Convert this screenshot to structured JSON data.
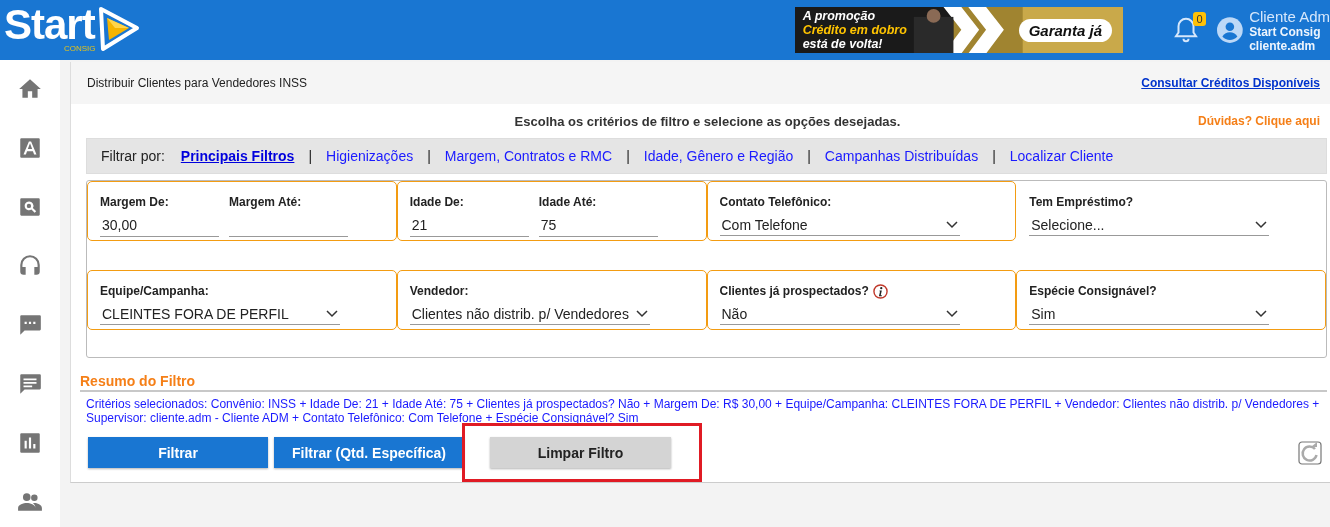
{
  "header": {
    "logo": "Start",
    "logo_sub": "CONSIG",
    "banner": {
      "line1": "A promoção",
      "line2": "Crédito em dobro",
      "line3": "está de volta!",
      "cta": "Garanta já"
    },
    "notifications": "0",
    "user": {
      "name": "Cliente Adm",
      "company": "Start Consig",
      "login": "cliente.adm"
    }
  },
  "sidebar": {
    "items": [
      {
        "kind": "home"
      },
      {
        "kind": "letter"
      },
      {
        "kind": "search"
      },
      {
        "kind": "headset"
      },
      {
        "kind": "chat"
      },
      {
        "kind": "message"
      },
      {
        "kind": "chart"
      },
      {
        "kind": "people"
      }
    ]
  },
  "page": {
    "title": "Distribuir Clientes para Vendedores INSS",
    "credits_link": "Consultar Créditos Disponíveis",
    "instruction": "Escolha os critérios de filtro e selecione as opções desejadas.",
    "help_link": "Dúvidas? Clique aqui"
  },
  "filter_tabs": {
    "label": "Filtrar por:",
    "tabs": [
      {
        "label": "Principais Filtros",
        "selected": true
      },
      {
        "separator": "|",
        "label": "Higienizações",
        "selected": false
      },
      {
        "separator": "|",
        "label": "Margem, Contratos e RMC",
        "selected": false
      },
      {
        "separator": "|",
        "label": "Idade, Gênero e Região",
        "selected": false
      },
      {
        "separator": "|",
        "label": "Campanhas Distribuídas",
        "selected": false
      },
      {
        "separator": "|",
        "label": "Localizar Cliente",
        "selected": false
      }
    ]
  },
  "filters": [
    {
      "kind": "pair",
      "highlighted": true,
      "fields": [
        {
          "label": "Margem De:",
          "value": "30,00"
        },
        {
          "label": "Margem Até:"
        }
      ]
    },
    {
      "kind": "pair",
      "highlighted": true,
      "fields": [
        {
          "label": "Idade De:",
          "value": "21"
        },
        {
          "label": "Idade Até:",
          "value": "75"
        }
      ]
    },
    {
      "kind": "select",
      "highlighted": true,
      "label": "Contato Telefônico:",
      "value": "Com Telefone",
      "info": false
    },
    {
      "kind": "select",
      "highlighted": false,
      "label": "Tem Empréstimo?",
      "value": "Selecione...",
      "info": false
    },
    {
      "kind": "select",
      "highlighted": true,
      "label": "Equipe/Campanha:",
      "value": "CLEINTES FORA DE PERFIL",
      "info": false
    },
    {
      "kind": "select",
      "highlighted": true,
      "label": "Vendedor:",
      "value": "Clientes não distrib. p/ Vendedores",
      "info": false
    },
    {
      "kind": "select",
      "highlighted": true,
      "label": "Clientes já prospectados?",
      "value": "Não",
      "info": true
    },
    {
      "kind": "select",
      "highlighted": true,
      "label": "Espécie Consignável?",
      "value": "Sim",
      "info": false
    }
  ],
  "summary": {
    "title": "Resumo do Filtro",
    "text": "Critérios selecionados: Convênio: INSS + Idade De: 21 + Idade Até: 75 + Clientes já prospectados? Não + Margem De: R$ 30,00 + Equipe/Campanha: CLEINTES FORA DE PERFIL + Vendedor: Clientes não distrib. p/ Vendedores + Supervisor: cliente.adm - Cliente ADM + Contato Telefônico: Com Telefone + Espécie Consignável? Sim"
  },
  "buttons": [
    {
      "label": "Filtrar",
      "kind": "primary",
      "highlighted": false
    },
    {
      "label": "Filtrar (Qtd. Específica)",
      "kind": "primary",
      "highlighted": false
    },
    {
      "label": "Limpar Filtro",
      "kind": "secondary",
      "highlighted": true
    }
  ]
}
